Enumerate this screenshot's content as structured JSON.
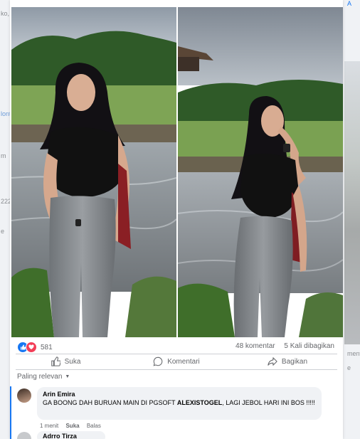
{
  "background": {
    "left_fragments": [
      "ko, N",
      "lonte",
      "m",
      "222",
      "e"
    ],
    "right_fragments": [
      "A",
      "mentar",
      "e"
    ]
  },
  "post": {
    "reaction_count": "581",
    "comments_count": "48 komentar",
    "shares_count": "5 Kali dibagikan",
    "actions": {
      "like": "Suka",
      "comment": "Komentari",
      "share": "Bagikan"
    },
    "sort_label": "Paling relevan",
    "comments": [
      {
        "author": "Arin Emira",
        "text_before": "GA BOONG DAH BURUAN MAIN DI PGSOFT ",
        "text_bold": "ALEXISTOGEL",
        "text_after": ", LAGI JEBOL HARI INI BOS !!!!!",
        "time": "1 menit",
        "like_label": "Suka",
        "reply_label": "Balas"
      },
      {
        "author": "Adrro Tirza"
      }
    ]
  },
  "colors": {
    "accent": "#1877f2",
    "love": "#f33e58",
    "muted_text": "#65676b",
    "bubble": "#f0f2f5"
  }
}
